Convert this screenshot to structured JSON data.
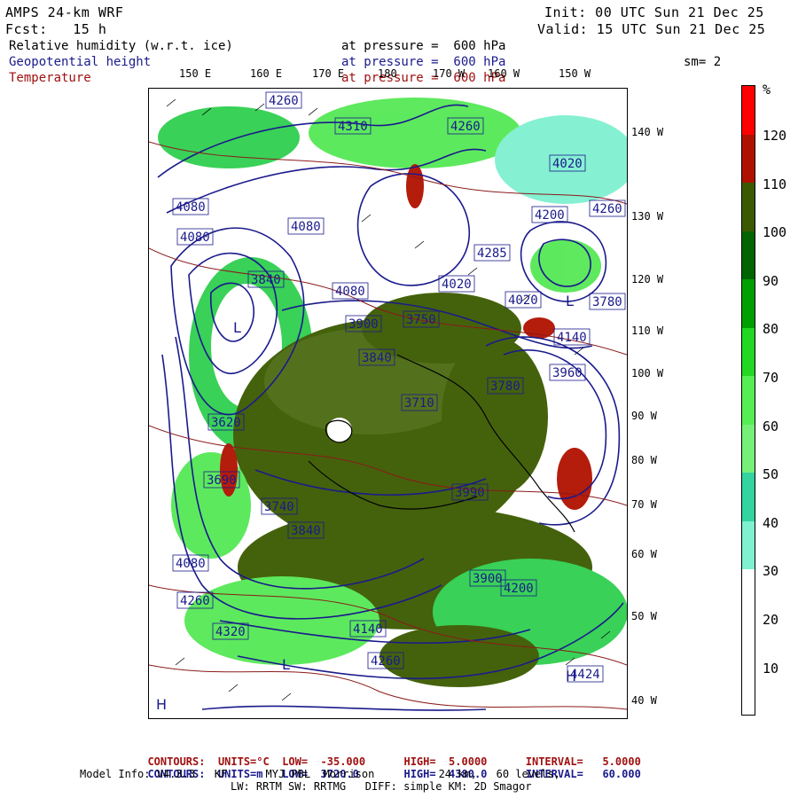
{
  "header": {
    "model": "AMPS 24-km WRF",
    "forecast": "Fcst:   15 h",
    "init": "Init: 00 UTC Sun 21 Dec 25",
    "valid": "Valid: 15 UTC Sun 21 Dec 25",
    "smoothing": "sm= 2"
  },
  "fields": [
    {
      "name": "Relative humidity (w.r.t. ice)",
      "level": "at pressure =  600 hPa",
      "color": "#000000"
    },
    {
      "name": "Geopotential height",
      "level": "at pressure =  600 hPa",
      "color": "#1a1a8c"
    },
    {
      "name": "Temperature",
      "level": "at pressure =  600 hPa",
      "color": "#a01010"
    }
  ],
  "longitude_labels": [
    "150 E",
    "160 E",
    "170 E",
    "180",
    "170 W",
    "160 W",
    "150 W"
  ],
  "latitude_labels": [
    "140 W",
    "130 W",
    "120 W",
    "110 W",
    "100 W",
    "90 W",
    "80 W",
    "70 W",
    "60 W",
    "50 W",
    "40 W"
  ],
  "height_labels": [
    "4260",
    "4310",
    "4260",
    "4080",
    "4080",
    "4200",
    "4260",
    "4080",
    "4020",
    "3840",
    "4080",
    "4020",
    "3900",
    "4020",
    "3780",
    "3840",
    "3710",
    "3780",
    "3960",
    "3620",
    "3740",
    "3840",
    "3690",
    "3900",
    "4080",
    "4260",
    "4320",
    "4140",
    "4260",
    "4200",
    "4424",
    "3990",
    "3750",
    "4140",
    "4285"
  ],
  "pressure_centers": [
    "L",
    "L",
    "L",
    "H",
    "H"
  ],
  "colorbar": {
    "unit": "%",
    "labels": [
      "120",
      "110",
      "100",
      "90",
      "80",
      "70",
      "60",
      "50",
      "40",
      "30",
      "20",
      "10"
    ],
    "colors": [
      "#ff0000",
      "#b01000",
      "#3b5a00",
      "#006400",
      "#00a000",
      "#22d822",
      "#55ef55",
      "#77f077",
      "#33d4a0",
      "#7ff0d0",
      "#ffffff",
      "#ffffff",
      "#ffffff"
    ]
  },
  "footer": {
    "temp_line": {
      "label": "CONTOURS:",
      "units": "UNITS=°C",
      "low": "LOW=  -35.000",
      "high": "HIGH=  5.0000",
      "interval": "INTERVAL=   5.0000",
      "color": "#a01010"
    },
    "height_line": {
      "label": "CONTOURS:",
      "units": "UNITS=m",
      "low": "LOW=  3720.0",
      "high": "HIGH=  4380.0",
      "interval": "INTERVAL=   60.000",
      "color": "#1a1a8c"
    },
    "model_info_1": "Model Info: V4.3.3   KF      MYJ PBL  Morrison          24 km,   60 levels,",
    "model_info_2": "LW: RRTM SW: RRTMG   DIFF: simple KM: 2D Smagor"
  }
}
